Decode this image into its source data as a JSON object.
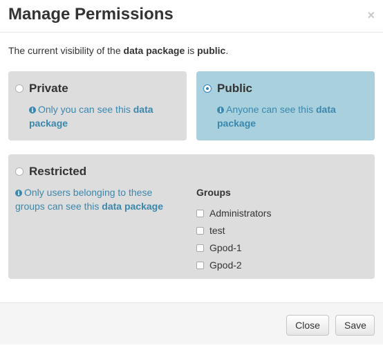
{
  "dialog": {
    "title": "Manage Permissions",
    "close_symbol": "×"
  },
  "intro": {
    "prefix": "The current visibility of the ",
    "object": "data package",
    "middle": " is ",
    "status": "public",
    "suffix": "."
  },
  "options": {
    "private": {
      "label": "Private",
      "selected": false,
      "desc_prefix": "Only you can see this ",
      "desc_object": "data package"
    },
    "public": {
      "label": "Public",
      "selected": true,
      "desc_prefix": "Anyone can see this ",
      "desc_object": "data package"
    },
    "restricted": {
      "label": "Restricted",
      "selected": false,
      "desc_line1": "Only users belonging to these",
      "desc_prefix": "groups can see this ",
      "desc_object": "data package"
    }
  },
  "groups": {
    "title": "Groups",
    "items": [
      {
        "label": "Administrators",
        "checked": false
      },
      {
        "label": "test",
        "checked": false
      },
      {
        "label": "Gpod-1",
        "checked": false
      },
      {
        "label": "Gpod-2",
        "checked": false
      }
    ]
  },
  "footer": {
    "close_label": "Close",
    "save_label": "Save"
  },
  "icons": {
    "info": "info-circle-icon",
    "info_glyph": "i"
  },
  "colors": {
    "selected_card": "#a9d1dd",
    "card": "#dddddd",
    "info_text": "#3a87ad"
  }
}
